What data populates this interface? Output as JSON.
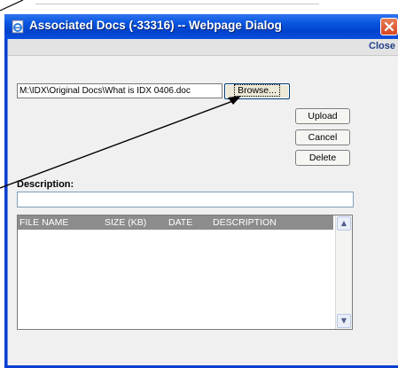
{
  "window": {
    "title": "Associated Docs (-33316) -- Webpage Dialog"
  },
  "toolbar": {
    "close_label": "Close"
  },
  "upload": {
    "file_path": "M:\\IDX\\Original Docs\\What is IDX 0406.doc",
    "browse_label": "Browse...",
    "upload_label": "Upload",
    "cancel_label": "Cancel",
    "delete_label": "Delete"
  },
  "description": {
    "label": "Description:",
    "value": ""
  },
  "file_list": {
    "columns": [
      "FILE NAME",
      "SIZE (KB)",
      "DATE",
      "DESCRIPTION"
    ],
    "rows": []
  },
  "icons": {
    "app": "ie-page-icon",
    "close": "close-x-icon",
    "scroll_up": "chevron-up-icon",
    "scroll_down": "chevron-down-icon"
  },
  "colors": {
    "titlebar": "#0a56e0",
    "client_bg": "#f0f0f0",
    "list_header": "#8c8c8c",
    "close_button": "#d7461f"
  }
}
